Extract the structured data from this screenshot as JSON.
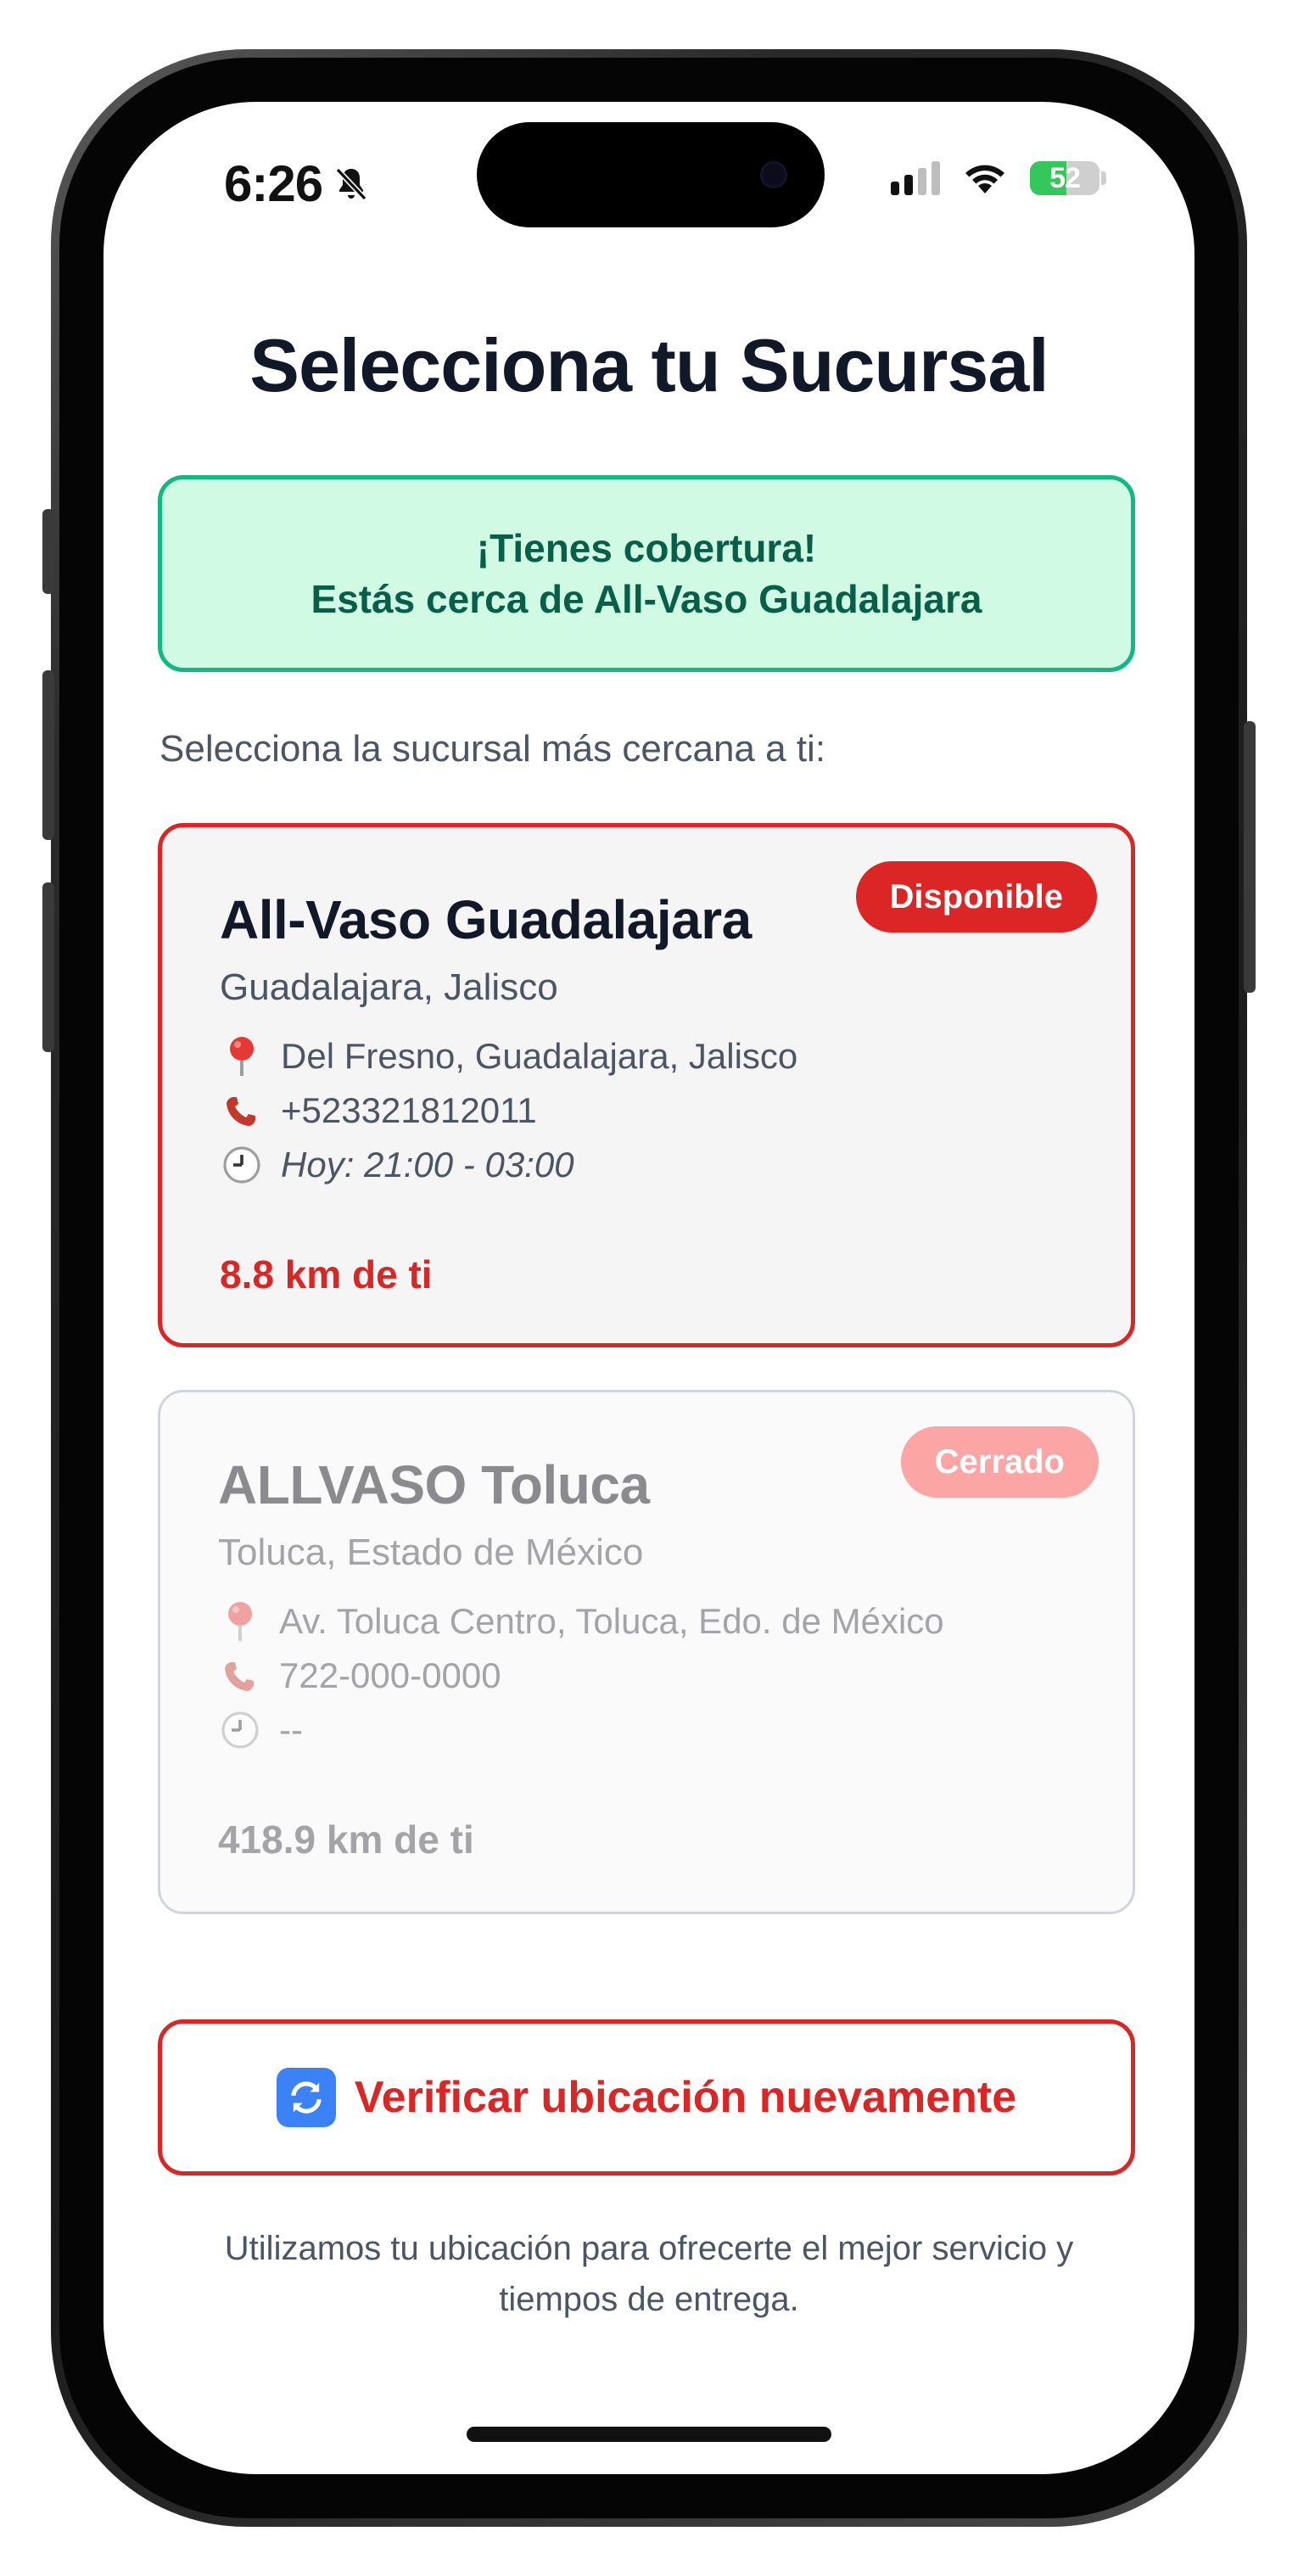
{
  "status_bar": {
    "time": "6:26",
    "battery": "52",
    "battery_level": 0.52
  },
  "page": {
    "title": "Selecciona tu Sucursal"
  },
  "coverage": {
    "line1": "¡Tienes cobertura!",
    "line2": "Estás cerca de All-Vaso Guadalajara"
  },
  "branches_label": "Selecciona la sucursal más cercana a ti:",
  "branches": [
    {
      "name": "All-Vaso Guadalajara",
      "city": "Guadalajara, Jalisco",
      "address": "Del Fresno, Guadalajara, Jalisco",
      "phone": "+523321812011",
      "hours": "Hoy: 21:00 - 03:00",
      "distance": "8.8 km de ti",
      "status": "Disponible"
    },
    {
      "name": "ALLVASO Toluca",
      "city": "Toluca, Estado de México",
      "address": "Av. Toluca Centro, Toluca, Edo. de México",
      "phone": "722-000-0000",
      "hours": "--",
      "distance": "418.9 km de ti",
      "status": "Cerrado"
    }
  ],
  "actions": {
    "verify_label": "Verificar ubicación nuevamente"
  },
  "footer": {
    "note": "Utilizamos tu ubicación para ofrecerte el mejor servicio y tiempos de entrega."
  },
  "colors": {
    "accent": "#dc2626",
    "success_border": "#10b981",
    "success_bg": "#d1fae5",
    "success_text": "#065f46",
    "closed_badge": "#fca5a5"
  },
  "icons": {
    "silent": "bell-slash-icon",
    "signal": "cellular-signal-icon",
    "wifi": "wifi-icon",
    "battery": "battery-charging-icon",
    "address": "map-pin-icon",
    "phone": "phone-icon",
    "hours": "clock-icon",
    "refresh": "refresh-icon"
  }
}
